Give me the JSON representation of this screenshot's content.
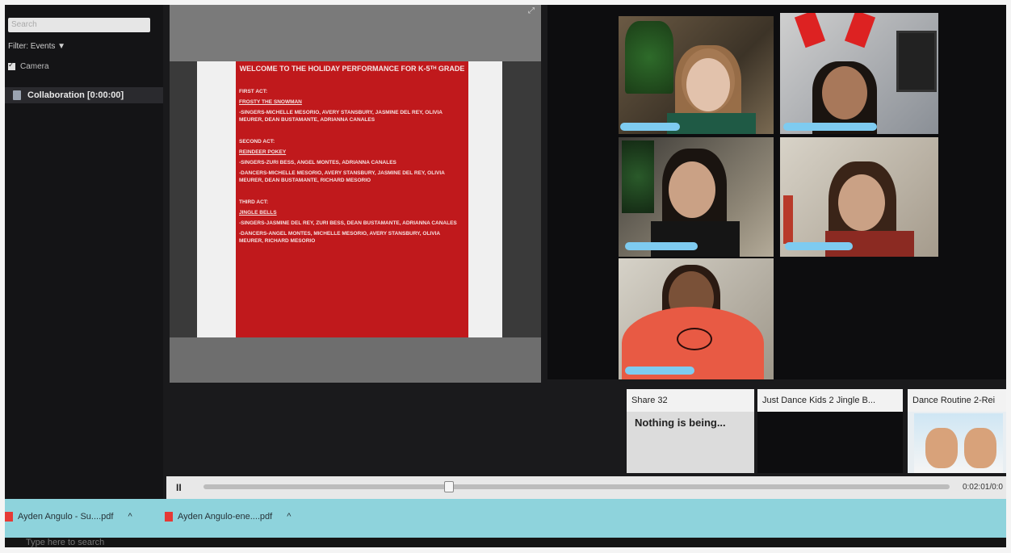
{
  "left_panel": {
    "search_placeholder": "Search",
    "filter_label": "Filter: Events ▼",
    "camera_label": "Camera",
    "collaboration_label": "Collaboration [0:00:00]"
  },
  "document": {
    "title": "WELCOME TO THE HOLIDAY PERFORMANCE FOR K-5ᵀᴴ GRADE",
    "first_act": "FIRST ACT:",
    "first_song": "FROSTY THE SNOWMAN",
    "first_singers": "-SINGERS-MICHELLE MESORIO, AVERY STANSBURY, JASMINE DEL REY, OLIVIA MEURER, DEAN BUSTAMANTE, ADRIANNA CANALES",
    "second_act": "SECOND ACT:",
    "second_song": "REINDEER POKEY",
    "second_singers": "-SINGERS-ZURI BESS, ANGEL MONTES, ADRIANNA CANALES",
    "second_dancers": "-DANCERS-MICHELLE MESORIO, AVERY STANSBURY, JASMINE DEL REY, OLIVIA MEURER, DEAN BUSTAMANTE, RICHARD MESORIO",
    "third_act": "THIRD ACT:",
    "third_song": "JINGLE BELLS",
    "third_singers": "-SINGERS-JASMINE DEL REY, ZURI BESS, DEAN BUSTAMANTE, ADRIANNA CANALES",
    "third_dancers": "-DANCERS-ANGEL MONTES, MICHELLE MESORIO, AVERY STANSBURY, OLIVIA MEURER, RICHARD MESORIO"
  },
  "shares": {
    "share_title": "Share 32",
    "share_body": "Nothing is being...",
    "share2_title": "Just Dance Kids 2 Jingle B...",
    "share3_title": "Dance Routine 2-Rei"
  },
  "player": {
    "time": "0:02:01/0:0"
  },
  "downloads": [
    {
      "label": "Ayden Angulo - Su....pdf"
    },
    {
      "label": "Ayden Angulo-ene....pdf"
    }
  ],
  "taskbar": {
    "search_placeholder": "Type here to search"
  },
  "colors": {
    "doc_red": "#c0191c",
    "blur_blue": "#7ecbf0",
    "download_bar": "#8ed3dc"
  }
}
